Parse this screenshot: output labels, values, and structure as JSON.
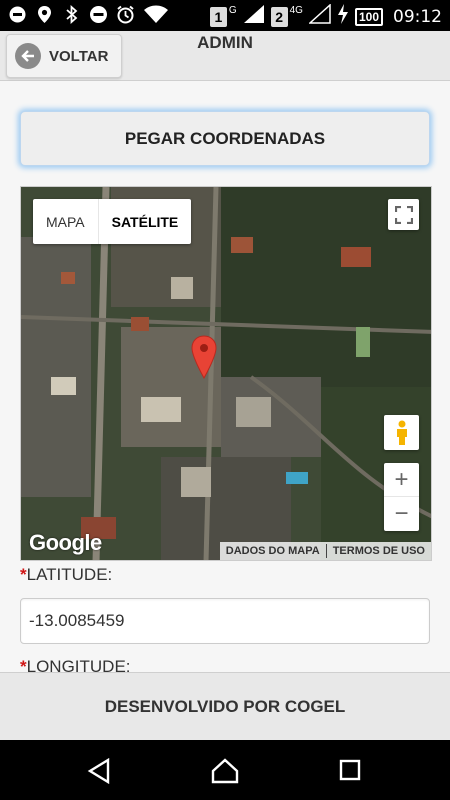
{
  "status_bar": {
    "time": "09:12",
    "sim1": "1",
    "sim1_network": "G",
    "sim2": "2",
    "sim2_network": "4G",
    "battery": "100",
    "icons": [
      "link-icon",
      "location-icon",
      "bluetooth-icon",
      "do-not-disturb-icon",
      "alarm-icon",
      "wifi-icon",
      "signal-icon",
      "charging-icon"
    ]
  },
  "header": {
    "back_label": "VOLTAR",
    "title": "ADMIN"
  },
  "main": {
    "get_coords_label": "PEGAR COORDENADAS",
    "map": {
      "type_map": "MAPA",
      "type_satellite": "SATÉLITE",
      "zoom_in": "+",
      "zoom_out": "−",
      "logo": "Google",
      "map_data": "DADOS DO MAPA",
      "terms": "TERMOS DE USO"
    },
    "latitude": {
      "required": "*",
      "label": "LATITUDE:",
      "value": "-13.0085459"
    },
    "longitude": {
      "required": "*",
      "label": "LONGITUDE:"
    }
  },
  "footer": {
    "text": "DESENVOLVIDO POR COGEL"
  },
  "colors": {
    "accent_glow": "#9ccaf2",
    "required": "#d01616",
    "marker": "#e84335"
  }
}
